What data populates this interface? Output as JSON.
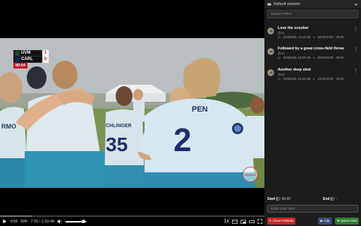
{
  "scorebug": {
    "team1": "UVM",
    "team1_score": "1",
    "team2": "CARL",
    "team2_score": "0",
    "clock": "89:04",
    "team1_color": "#1e4d2b",
    "team2_color": "#0a2a5e"
  },
  "player_numbers": {
    "main": "2",
    "secondary": "35"
  },
  "jersey_text": {
    "main": "PEN",
    "secondary": "CHLINGER",
    "left": "RMO"
  },
  "watermark": "STUDIO",
  "controls": {
    "play_icon": "play-icon",
    "skip_back_label": "↺10",
    "skip_fwd_label": "10↻",
    "time": "7:20 / 1:33:48",
    "speed": "1x",
    "progress_fraction": 0.078,
    "buffer_fraction": 0.12,
    "volume_fraction": 0.85
  },
  "panel": {
    "session_label": "Default session",
    "search_placeholder": "Search notes",
    "notes": [
      {
        "title": "Love the scoober",
        "user": "@rut",
        "date": "4/15/2025, 12:40 AM",
        "timestamp": "00:00:00:00",
        "duration": "00:05"
      },
      {
        "title": "Followed by a great cross-field throw",
        "user": "@rut",
        "date": "4/15/2025, 12:40 AM",
        "timestamp": "00:00:03:00",
        "duration": "00:05"
      },
      {
        "title": "Another deep shot",
        "user": "@rut",
        "date": "4/15/2025, 12:40 AM",
        "timestamp": "14:02:19:00",
        "duration": "00:05"
      }
    ],
    "start_label": "Start (",
    "start_key": "[",
    "start_suffix": "): 00:00",
    "end_label": "End (",
    "end_key": "]",
    "end_suffix": "): -",
    "note_placeholder": "Enter note here",
    "close_button": "✕ Close GWinds",
    "clip_button": "▶ Clip",
    "quick_button": "✚ Quick Note"
  },
  "colors": {
    "accent_red": "#e53935",
    "close_red": "#c62828",
    "quick_green": "#2e7d32",
    "clip_blue": "#3a4a7a"
  }
}
